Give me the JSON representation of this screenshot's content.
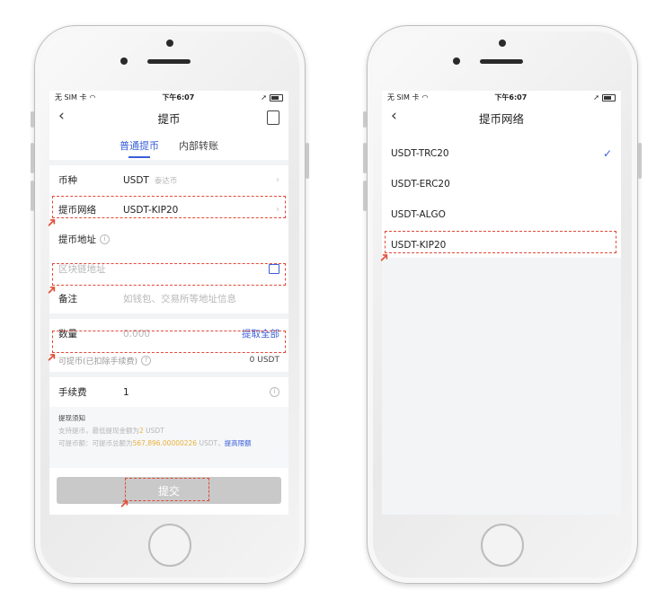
{
  "left_screen": {
    "status": {
      "carrier": "无 SIM 卡",
      "time": "下午6:07"
    },
    "title": "提币",
    "tabs": [
      {
        "label": "普通提币"
      },
      {
        "label": "内部转账"
      }
    ],
    "currency": {
      "label": "币种",
      "value": "USDT",
      "hint": "泰达币"
    },
    "network": {
      "label": "提币网络",
      "value": "USDT-KIP20"
    },
    "address": {
      "label": "提币地址",
      "placeholder": "区块链地址"
    },
    "memo": {
      "label": "备注",
      "placeholder": "如钱包、交易所等地址信息"
    },
    "amount": {
      "label": "数量",
      "placeholder": "0.000",
      "all_label": "提取全部"
    },
    "available": {
      "label": "可提币(已扣除手续费)",
      "value": "0 USDT"
    },
    "fee": {
      "label": "手续费",
      "value": "1"
    },
    "notice": {
      "title": "提现须知",
      "line1_a": "支持提币，最低提现金额为",
      "line1_hl": "2",
      "line1_b": " USDT",
      "line2_a": "可提币额：可提币总额为",
      "line2_hl": "567,896.00000226",
      "line2_b": " USDT，",
      "line2_link": "提高限额"
    },
    "submit_label": "提交"
  },
  "right_screen": {
    "status": {
      "carrier": "无 SIM 卡",
      "time": "下午6:07"
    },
    "title": "提币网络",
    "networks": [
      {
        "label": "USDT-TRC20",
        "selected": true
      },
      {
        "label": "USDT-ERC20",
        "selected": false
      },
      {
        "label": "USDT-ALGO",
        "selected": false
      },
      {
        "label": "USDT-KIP20",
        "selected": false
      }
    ],
    "check_mark": "✓"
  },
  "colors": {
    "accent": "#3a5fd9",
    "annotation": "#e04a3a",
    "highlight": "#e8b23a"
  }
}
